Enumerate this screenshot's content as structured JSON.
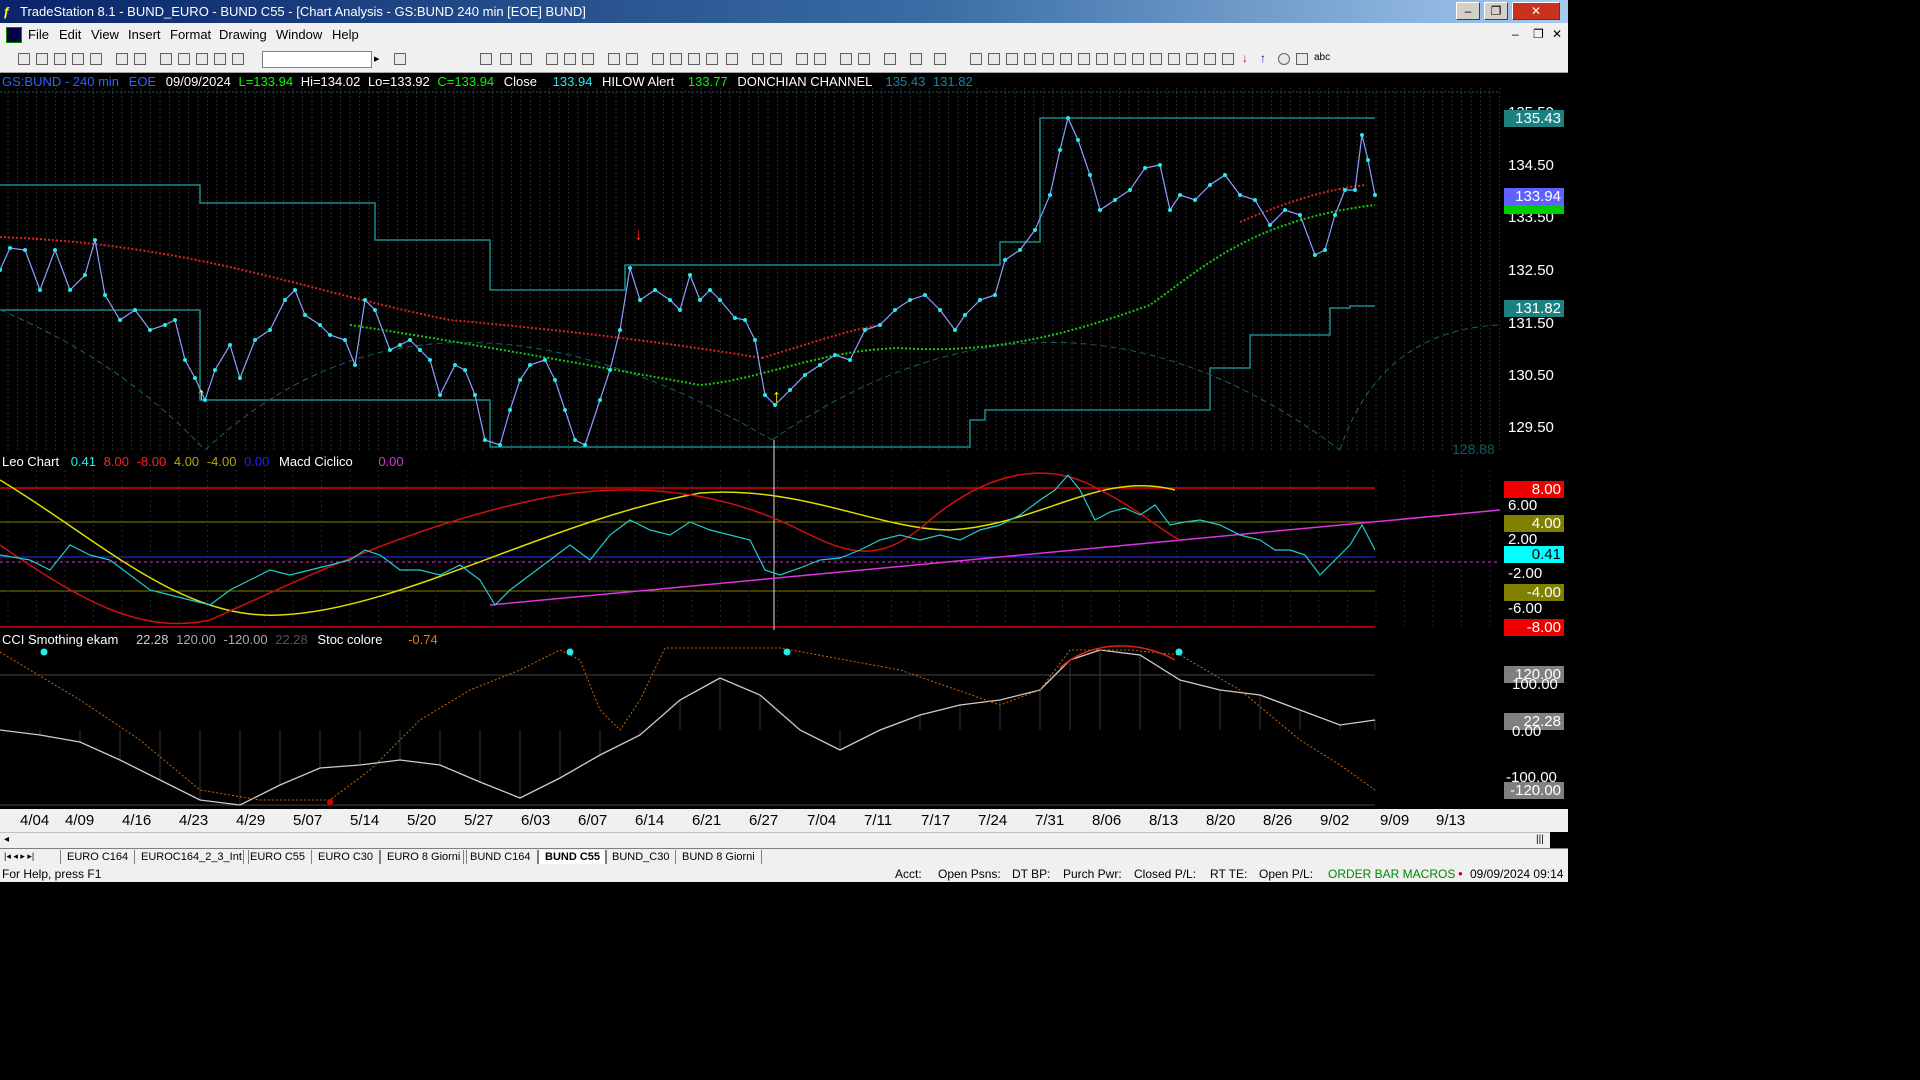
{
  "window": {
    "title": "TradeStation 8.1 - BUND_EURO - BUND C55 - [Chart Analysis - GS:BUND  240 min  [EOE] BUND]"
  },
  "menu": [
    "File",
    "Edit",
    "View",
    "Insert",
    "Format",
    "Drawing",
    "Window",
    "Help"
  ],
  "chart_header": {
    "symbol": "GS:BUND - 240 min",
    "session": "EOE",
    "date": "09/09/2024",
    "last": "L=133.94",
    "high": "Hi=134.02",
    "low": "Lo=133.92",
    "close": "C=133.94",
    "close_lbl": "Close",
    "close_val": "133.94",
    "hilow": "HILOW Alert",
    "hilow_val": "133.77",
    "donch": "DONCHIAN CHANNEL",
    "donch_hi": "135.43",
    "donch_lo": "131.82"
  },
  "leo_header": {
    "name": "Leo Chart",
    "v1": "0.41",
    "v2": "8.00",
    "v3": "-8.00",
    "v4": "4.00",
    "v5": "-4.00",
    "v6": "0.00",
    "macd": "Macd Ciclico",
    "macd_val": "0.00"
  },
  "cci_header": {
    "name": "CCI Smothing ekam",
    "v1": "22.28",
    "v2": "120.00",
    "v3": "-120.00",
    "v4": "22.28",
    "stoc": "Stoc colore",
    "stoc_val": "-0.74"
  },
  "price_axis": [
    "135.50",
    "134.50",
    "133.50",
    "132.50",
    "131.50",
    "130.50",
    "129.50"
  ],
  "price_boxes": {
    "hi": "135.43",
    "last": "133.94",
    "lo": "131.82",
    "faint": "128.88"
  },
  "leo_axis": [
    "8.00",
    "6.00",
    "4.00",
    "2.00",
    "0.41",
    "-2.00",
    "-4.00",
    "-6.00",
    "-8.00"
  ],
  "cci_axis": [
    "120.00",
    "100.00",
    "22.28",
    "0.00",
    "-100.00",
    "-120.00"
  ],
  "dates": [
    "4/04",
    "4/09",
    "4/16",
    "4/23",
    "4/29",
    "5/07",
    "5/14",
    "5/20",
    "5/27",
    "6/03",
    "6/07",
    "6/14",
    "6/21",
    "6/27",
    "7/04",
    "7/11",
    "7/17",
    "7/24",
    "7/31",
    "8/06",
    "8/13",
    "8/20",
    "8/26",
    "9/02",
    "9/09",
    "9/13"
  ],
  "tabs": [
    "EURO C164",
    "EUROC164_2_3_Int",
    "EURO C55",
    "EURO C30",
    "EURO 8 Giorni",
    "BUND C164",
    "BUND C55",
    "BUND_C30",
    "BUND 8 Giorni"
  ],
  "active_tab": "BUND C55",
  "status": {
    "help": "For Help, press F1",
    "acct": "Acct:",
    "open_psns": "Open Psns:",
    "dt_bp": "DT BP:",
    "purch": "Purch Pwr:",
    "closed": "Closed P/L:",
    "rt": "RT TE:",
    "open_pl": "Open P/L:",
    "macros": "ORDER BAR  MACROS",
    "datetime": "09/09/2024 09:14"
  },
  "chart_data": {
    "type": "line",
    "title": "GS:BUND - 240 min",
    "series": [
      {
        "name": "Close",
        "values": [
          132.7,
          132.3,
          131.6,
          130.6,
          130.2,
          131.2,
          132.0,
          131.4,
          131.0,
          130.9,
          129.5,
          130.8,
          129.5,
          132.8,
          132.4,
          131.3,
          129.8,
          131.1,
          131.9,
          132.5,
          133.4,
          135.3,
          133.9,
          134.5,
          134.0,
          133.9,
          133.2,
          134.7,
          133.94
        ]
      }
    ],
    "ylim": [
      129.0,
      135.8
    ]
  }
}
